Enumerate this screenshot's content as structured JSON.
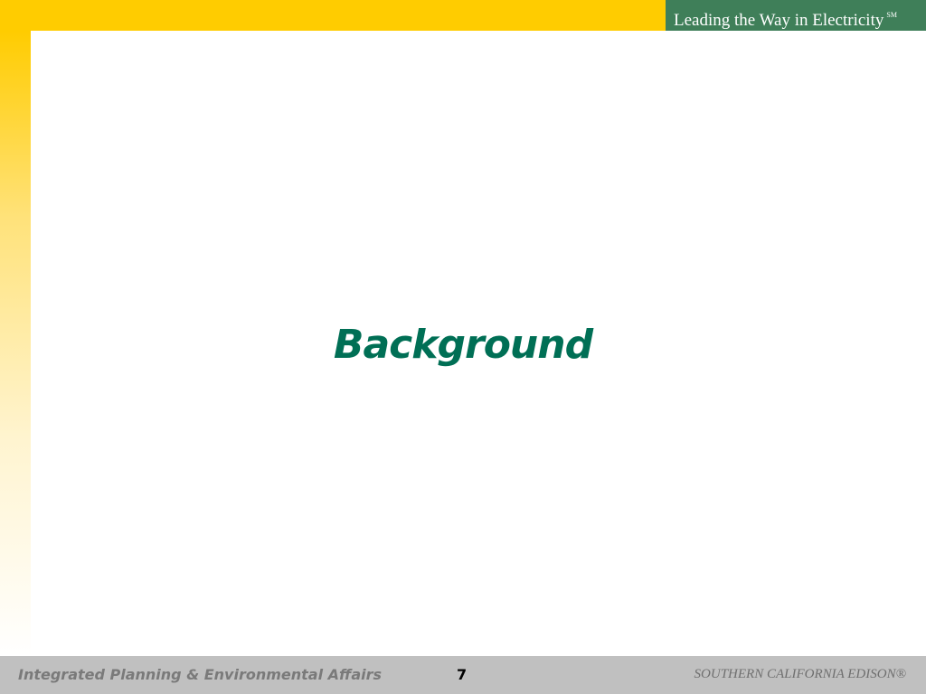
{
  "header": {
    "tagline": "Leading the Way in Electricity",
    "tagline_mark": "SM"
  },
  "slide": {
    "title": "Background"
  },
  "footer": {
    "department": "Integrated Planning & Environmental Affairs",
    "page_number": "7",
    "company": "SOUTHERN CALIFORNIA EDISON®"
  },
  "colors": {
    "top_bar": "#ffcc00",
    "tagline_box": "#3f7f59",
    "title": "#006f55",
    "footer_bar": "#c0c0c0"
  }
}
